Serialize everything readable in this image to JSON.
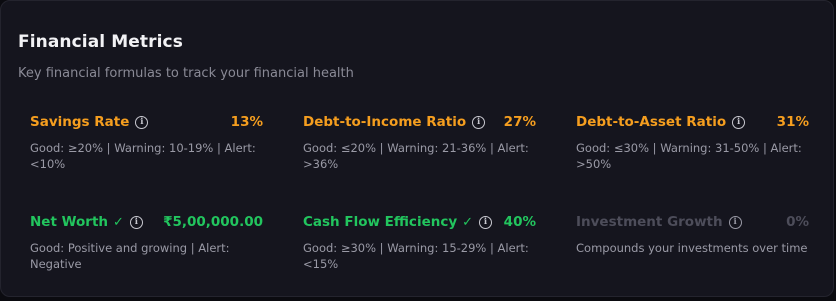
{
  "header": {
    "title": "Financial Metrics",
    "subtitle": "Key financial formulas to track your financial health"
  },
  "colors": {
    "warning": "#f59e1f",
    "good": "#22c55e",
    "muted": "#4d4d5a"
  },
  "metrics": [
    {
      "name": "Savings Rate",
      "value": "13%",
      "status": "warning",
      "icon": "info-icon",
      "desc": "Good: ≥20% | Warning: 10-19% | Alert: <10%"
    },
    {
      "name": "Debt-to-Income Ratio",
      "value": "27%",
      "status": "warning",
      "icon": "info-icon",
      "desc": "Good: ≤20% | Warning: 21-36% | Alert: >36%"
    },
    {
      "name": "Debt-to-Asset Ratio",
      "value": "31%",
      "status": "warning",
      "icon": "info-icon",
      "desc": "Good: ≤30% | Warning: 31-50% | Alert: >50%"
    },
    {
      "name": "Net Worth",
      "check": "✓",
      "value": "₹5,00,000.00",
      "status": "good",
      "icon": "info-icon",
      "desc": "Good: Positive and growing | Alert: Negative"
    },
    {
      "name": "Cash Flow Efficiency",
      "check": "✓",
      "value": "40%",
      "status": "good",
      "icon": "info-icon",
      "desc": "Good: ≥30% | Warning: 15-29% | Alert: <15%"
    },
    {
      "name": "Investment Growth",
      "value": "0%",
      "status": "muted",
      "icon": "info-icon",
      "desc": "Compounds your investments over time"
    }
  ]
}
